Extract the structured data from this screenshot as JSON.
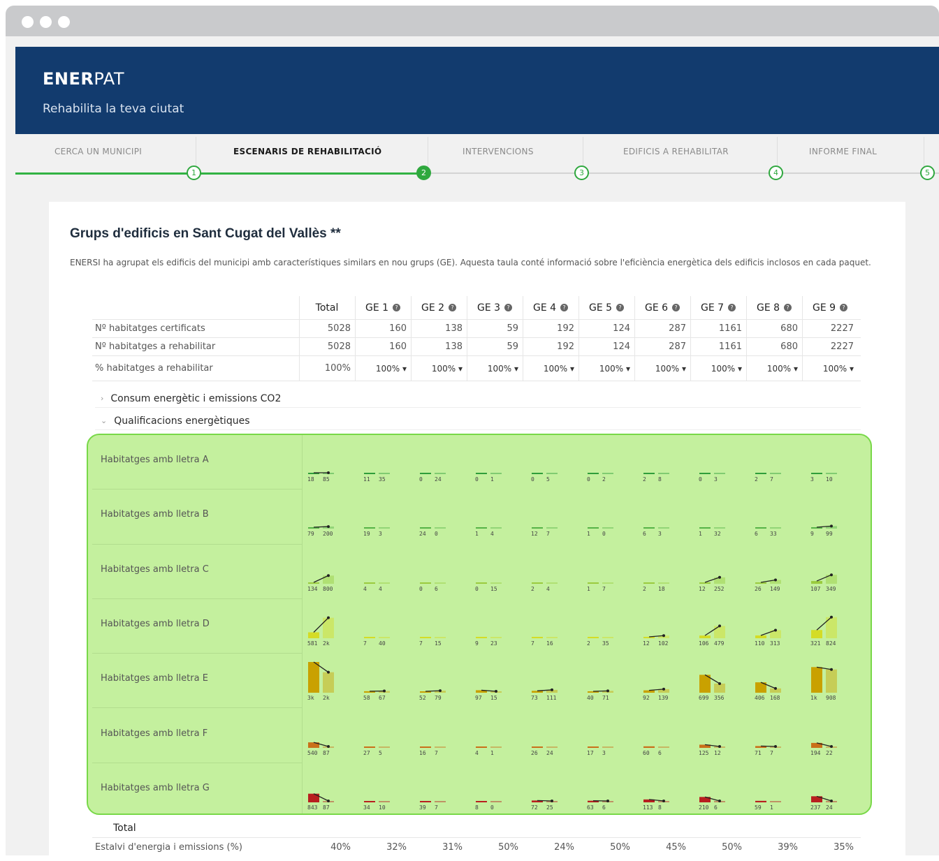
{
  "app": {
    "brand_bold": "ENER",
    "brand_light": "PAT",
    "tagline": "Rehabilita la teva ciutat"
  },
  "steps": [
    {
      "label": "CERCA UN MUNICIPI",
      "num": "1"
    },
    {
      "label": "ESCENARIS DE REHABILITACIÓ",
      "num": "2",
      "active": true
    },
    {
      "label": "INTERVENCIONS",
      "num": "3"
    },
    {
      "label": "EDIFICIS A REHABILITAR",
      "num": "4"
    },
    {
      "label": "INFORME FINAL",
      "num": "5"
    }
  ],
  "page": {
    "title": "Grups d'edificis en Sant Cugat del Vallès **",
    "description": "ENERSI ha agrupat els edificis del municipi amb característiques similars en nou grups (GE). Aquesta taula conté informació sobre l'eficiència energètica dels edificis inclosos en cada paquet."
  },
  "table": {
    "columns": [
      "Total",
      "GE 1",
      "GE 2",
      "GE 3",
      "GE 4",
      "GE 5",
      "GE 6",
      "GE 7",
      "GE 8",
      "GE 9"
    ],
    "rows": [
      {
        "label": "Nº habitatges certificats",
        "values": [
          "5028",
          "160",
          "138",
          "59",
          "192",
          "124",
          "287",
          "1161",
          "680",
          "2227"
        ]
      },
      {
        "label": "Nº habitatges a rehabilitar",
        "values": [
          "5028",
          "160",
          "138",
          "59",
          "192",
          "124",
          "287",
          "1161",
          "680",
          "2227"
        ]
      },
      {
        "label": "% habitatges a rehabilitar",
        "values": [
          "100%",
          "100% ▾",
          "100% ▾",
          "100% ▾",
          "100% ▾",
          "100% ▾",
          "100% ▾",
          "100% ▾",
          "100% ▾",
          "100% ▾"
        ]
      }
    ],
    "sections": [
      {
        "label": "Consum energètic i emissions CO2",
        "chevron": "›"
      },
      {
        "label": "Qualificacions energètiques",
        "chevron": "⌄"
      }
    ],
    "total_label": "Total",
    "savings": {
      "label": "Estalvi d'energia i emissions (%)",
      "values": [
        "40%",
        "32%",
        "31%",
        "50%",
        "24%",
        "50%",
        "45%",
        "50%",
        "39%",
        "35%"
      ]
    }
  },
  "ratings": {
    "colors": {
      "A": "#2f9e3a",
      "B": "#56b347",
      "C": "#9acb3e",
      "D": "#d4dc26",
      "E": "#c9a100",
      "F": "#c9701a",
      "G": "#b81f1f"
    },
    "rows": [
      {
        "letter": "A",
        "label": "Habitatges amb lletra A",
        "pairs": [
          [
            "18",
            "85"
          ],
          [
            "11",
            "35"
          ],
          [
            "0",
            "24"
          ],
          [
            "0",
            "1"
          ],
          [
            "0",
            "5"
          ],
          [
            "0",
            "2"
          ],
          [
            "2",
            "8"
          ],
          [
            "0",
            "3"
          ],
          [
            "2",
            "7"
          ],
          [
            "3",
            "10"
          ]
        ]
      },
      {
        "letter": "B",
        "label": "Habitatges amb lletra B",
        "pairs": [
          [
            "79",
            "200"
          ],
          [
            "19",
            "3"
          ],
          [
            "24",
            "0"
          ],
          [
            "1",
            "4"
          ],
          [
            "12",
            "7"
          ],
          [
            "1",
            "0"
          ],
          [
            "6",
            "3"
          ],
          [
            "1",
            "32"
          ],
          [
            "6",
            "33"
          ],
          [
            "9",
            "99"
          ]
        ]
      },
      {
        "letter": "C",
        "label": "Habitatges amb lletra C",
        "pairs": [
          [
            "134",
            "800"
          ],
          [
            "4",
            "4"
          ],
          [
            "0",
            "6"
          ],
          [
            "0",
            "15"
          ],
          [
            "2",
            "4"
          ],
          [
            "1",
            "7"
          ],
          [
            "2",
            "18"
          ],
          [
            "12",
            "252"
          ],
          [
            "26",
            "149"
          ],
          [
            "107",
            "349"
          ]
        ]
      },
      {
        "letter": "D",
        "label": "Habitatges amb lletra D",
        "pairs": [
          [
            "581",
            "2k"
          ],
          [
            "7",
            "40"
          ],
          [
            "7",
            "15"
          ],
          [
            "9",
            "23"
          ],
          [
            "7",
            "16"
          ],
          [
            "2",
            "35"
          ],
          [
            "12",
            "102"
          ],
          [
            "106",
            "479"
          ],
          [
            "110",
            "313"
          ],
          [
            "321",
            "824"
          ]
        ]
      },
      {
        "letter": "E",
        "label": "Habitatges amb lletra E",
        "pairs": [
          [
            "3k",
            "2k"
          ],
          [
            "58",
            "67"
          ],
          [
            "52",
            "79"
          ],
          [
            "97",
            "15"
          ],
          [
            "73",
            "111"
          ],
          [
            "40",
            "71"
          ],
          [
            "92",
            "139"
          ],
          [
            "699",
            "356"
          ],
          [
            "406",
            "168"
          ],
          [
            "1k",
            "908"
          ]
        ]
      },
      {
        "letter": "F",
        "label": "Habitatges amb lletra F",
        "pairs": [
          [
            "540",
            "87"
          ],
          [
            "27",
            "5"
          ],
          [
            "16",
            "7"
          ],
          [
            "4",
            "1"
          ],
          [
            "26",
            "24"
          ],
          [
            "17",
            "3"
          ],
          [
            "60",
            "6"
          ],
          [
            "125",
            "12"
          ],
          [
            "71",
            "7"
          ],
          [
            "194",
            "22"
          ]
        ]
      },
      {
        "letter": "G",
        "label": "Habitatges amb lletra G",
        "pairs": [
          [
            "843",
            "87"
          ],
          [
            "34",
            "10"
          ],
          [
            "39",
            "7"
          ],
          [
            "8",
            "0"
          ],
          [
            "72",
            "25"
          ],
          [
            "63",
            "6"
          ],
          [
            "113",
            "8"
          ],
          [
            "210",
            "6"
          ],
          [
            "59",
            "1"
          ],
          [
            "237",
            "24"
          ]
        ]
      }
    ]
  }
}
